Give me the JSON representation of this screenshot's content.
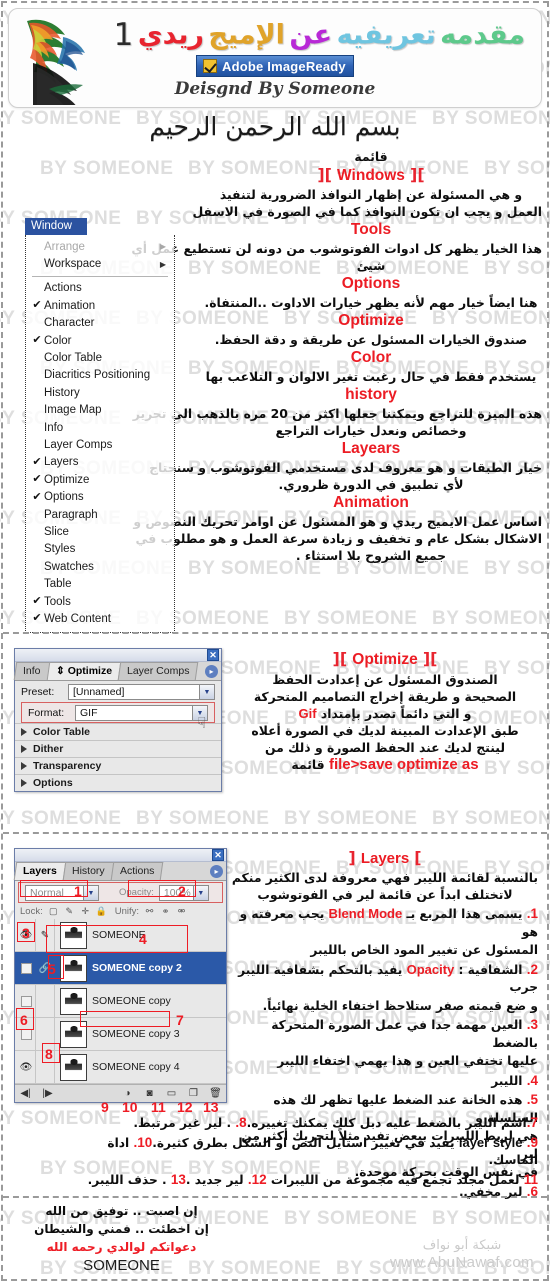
{
  "header": {
    "title_parts": [
      {
        "text": "مقدمه",
        "color": "#5dc98b"
      },
      {
        "text": "تعريفيه",
        "color": "#6fc5e0"
      },
      {
        "text": "عن",
        "color": "#b829d6"
      },
      {
        "text": "الإميج",
        "color": "#e0a32a"
      },
      {
        "text": "ريدي",
        "color": "#e8242f"
      },
      {
        "text": "1",
        "color": "#2b2b2b"
      }
    ],
    "app_badge": "Adobe ImageReady",
    "app_badge_icon": "imageready-icon",
    "designed_by": "Deisgnd By Someone"
  },
  "basmala": "بسم الله الرحمن الرحيم",
  "watermark_text": "BY SOMEONE",
  "section1": {
    "menu": {
      "title": "Window",
      "items": [
        {
          "label": "Arrange",
          "checked": false,
          "disabled": true,
          "submenu": true
        },
        {
          "label": "Workspace",
          "checked": false,
          "disabled": false,
          "submenu": true
        },
        {
          "divider": true
        },
        {
          "label": "Actions",
          "checked": false,
          "disabled": false,
          "submenu": false
        },
        {
          "label": "Animation",
          "checked": true,
          "disabled": false,
          "submenu": false
        },
        {
          "label": "Character",
          "checked": false,
          "disabled": false,
          "submenu": false
        },
        {
          "label": "Color",
          "checked": true,
          "disabled": false,
          "submenu": false
        },
        {
          "label": "Color Table",
          "checked": false,
          "disabled": false,
          "submenu": false
        },
        {
          "label": "Diacritics Positioning",
          "checked": false,
          "disabled": false,
          "submenu": false
        },
        {
          "label": "History",
          "checked": false,
          "disabled": false,
          "submenu": false
        },
        {
          "label": "Image Map",
          "checked": false,
          "disabled": false,
          "submenu": false
        },
        {
          "label": "Info",
          "checked": false,
          "disabled": false,
          "submenu": false
        },
        {
          "label": "Layer Comps",
          "checked": false,
          "disabled": false,
          "submenu": false
        },
        {
          "label": "Layers",
          "checked": true,
          "disabled": false,
          "submenu": false
        },
        {
          "label": "Optimize",
          "checked": true,
          "disabled": false,
          "submenu": false
        },
        {
          "label": "Options",
          "checked": true,
          "disabled": false,
          "submenu": false
        },
        {
          "label": "Paragraph",
          "checked": false,
          "disabled": false,
          "submenu": false
        },
        {
          "label": "Slice",
          "checked": false,
          "disabled": false,
          "submenu": false
        },
        {
          "label": "Styles",
          "checked": false,
          "disabled": false,
          "submenu": false
        },
        {
          "label": "Swatches",
          "checked": false,
          "disabled": false,
          "submenu": false
        },
        {
          "label": "Table",
          "checked": false,
          "disabled": false,
          "submenu": false
        },
        {
          "label": "Tools",
          "checked": true,
          "disabled": false,
          "submenu": false
        },
        {
          "label": "Web Content",
          "checked": true,
          "disabled": false,
          "submenu": false
        }
      ]
    },
    "heading_word": "قائمة",
    "heading_keyword": "Windows",
    "intro_line1": "و هي المسئولة عن إظهار النوافذ الضرورية لتنفيذ",
    "intro_line2": "العمل و يجب ان تكون النوافذ كما في الصورة في الاسفل",
    "entries": [
      {
        "keyword": "Tools",
        "lines": [
          "هذا الخيار يظهر كل ادوات الفوتوشوب من دونه لن تستطيع عمل أي",
          "شيئ"
        ]
      },
      {
        "keyword": "Options",
        "lines": [
          "هنا ايضاً خيار مهم لأنه يظهر خيارات الاداوت ..المنتفاة."
        ]
      },
      {
        "keyword": "Optimize",
        "lines": [
          "صندوق الخيارات المسئول عن طريقة و دقة الحفظ."
        ]
      },
      {
        "keyword": "Color",
        "lines": [
          "يستخدم فقط في حال رغبت تغير الالوان و التلاعب بها"
        ]
      },
      {
        "keyword": "history",
        "lines": [
          "هذه الميزة للتراجع ويمكننا جعلها اكثر من 20 مره بالذهب الى تحرير",
          "وخصائص ونعدل خيارات التراجع"
        ]
      },
      {
        "keyword": "Layears",
        "lines": [
          "خيار الطبقات و هو معروف لدى مستخدمي الفوتوشوب و سنحتاج",
          "لأي تطبيق في  الدورة ظروري."
        ]
      },
      {
        "keyword": "Animation",
        "lines": [
          "اساس عمل الايميج ريدي و هو المسئول عن اوامر تحريك النصوص و",
          "الاشكال بشكل عام و تخفيف و زيادة سرعة العمل و هو مطلوب في",
          "جميع الشروح بلا استثاء ."
        ]
      }
    ]
  },
  "section2": {
    "panel": {
      "close_icon": "close-icon",
      "tabs": [
        {
          "label": "Info",
          "active": false
        },
        {
          "label": "Optimize",
          "active": true
        },
        {
          "label": "Layer Comps",
          "active": false
        }
      ],
      "menu_icon": "panel-menu-icon",
      "hand_icon": "hand-icon",
      "preset_label": "Preset:",
      "preset_value": "[Unnamed]",
      "format_label": "Format:",
      "format_value": "GIF",
      "collapsed_sections": [
        "Color Table",
        "Dither",
        "Transparency",
        "Options"
      ]
    },
    "heading_keyword": "Optimize",
    "lines": [
      "الصندوق المسئول عن إعدادت الحفظ",
      "الصحيحة و طريقة إخراج التصاميم المتحركة"
    ],
    "line_gif_pre": "و التي دائماً تصدر بإمتداد",
    "line_gif_kw": "Gif",
    "lines2": [
      "طبق الإعدادت المبينة لديك في  الصورة أعلاه",
      "لينتج لديك عند الحفظ الصورة و ذلك من"
    ],
    "line_save_pre": "قائمة",
    "line_save_kw": "file>save optimize as"
  },
  "section3": {
    "panel": {
      "close_icon": "close-icon",
      "tabs": [
        {
          "label": "Layers",
          "active": true
        },
        {
          "label": "History",
          "active": false
        },
        {
          "label": "Actions",
          "active": false
        }
      ],
      "menu_icon": "panel-menu-icon",
      "blend_mode_value": "Normal",
      "opacity_label": "Opacity:",
      "opacity_value": "100%",
      "lock_label": "Lock:",
      "unify_label": "Unify:",
      "layers": [
        {
          "name": "SOMEONE",
          "visible": true,
          "selected": false,
          "linked": false
        },
        {
          "name": "SOMEONE copy 2",
          "visible": false,
          "selected": true,
          "linked": true
        },
        {
          "name": "SOMEONE copy",
          "visible": false,
          "selected": false,
          "linked": false
        },
        {
          "name": "SOMEONE copy 3",
          "visible": false,
          "selected": false,
          "linked": false
        },
        {
          "name": "SOMEONE copy 4",
          "visible": true,
          "selected": false,
          "linked": false
        }
      ],
      "footer_icons": [
        "nav-prev-icon",
        "nav-next-icon",
        "layer-style-icon",
        "mask-icon",
        "new-group-icon",
        "new-layer-icon",
        "delete-layer-icon"
      ],
      "annotations": [
        "1",
        "2",
        "3",
        "4",
        "5",
        "6",
        "7",
        "8",
        "9",
        "10",
        "11",
        "12",
        "13"
      ]
    },
    "heading_keyword": "Layers",
    "intro_lines": [
      "بالنسبة لقائمة الليبر فهي معروفة لدى الكثير منكم فهي",
      "لاتختلف ابداً عن قائمة لير في الفوتوشوب"
    ],
    "items": [
      {
        "num": "1.",
        "pre": "يسمى هذا المربع بـ",
        "kw": "Blend Mode",
        "post": "يجب معرفته و هو",
        "cont": "المسئول عن تغيير المود الخاص بالليبر"
      },
      {
        "num": "2.",
        "pre": "الشفافية :",
        "kw": "Opacity",
        "post": "يفيد بالتحكم بشفافية الليبر جرب",
        "cont": "و ضع قيمته صفر ستلاحظ اختفاء الخلية نهائياً."
      },
      {
        "num": "3.",
        "pre": "العين مهمة جدا في عمل الصورة المتحركة بالضغط",
        "kw": "",
        "post": "",
        "cont": "عليها تختفي العين و هذا يهمي اختفاء الليبر"
      },
      {
        "num": "4.",
        "pre": "الليبر",
        "kw": "",
        "post": "",
        "cont": ""
      },
      {
        "num": "5.",
        "pre": "هذه الخانة عند الضغط عليها تظهر لك هذه السلسلة و",
        "kw": "",
        "post": "",
        "cont": "هي لربط الليبرات ببعض تفيد مثلاً لتحريك أكثر من لير",
        "cont2": "في نفس الوقت بحركة موحدة."
      },
      {
        "num": "6.",
        "pre": "لير مخفي.",
        "kw": "",
        "post": "",
        "cont": ""
      }
    ],
    "tail_lines": [
      {
        "segments": [
          {
            "t": "7.",
            "red": true
          },
          {
            "t": "اسم الليبر بالضغط عليه دبل كلك يمكنك تغييره.",
            "red": false
          },
          {
            "t": "8.",
            "red": true
          },
          {
            "t": " . لير غير مرتبط.",
            "red": false
          }
        ]
      },
      {
        "segments": [
          {
            "t": "9.",
            "red": true
          },
          {
            "t": " ",
            "red": false
          },
          {
            "t": "layer style",
            "red": false,
            "ltr": true
          },
          {
            "t": " يفيد في تغيير استايل النص او الشكل بطرق كثيرة.",
            "red": false
          },
          {
            "t": "10.",
            "red": true
          },
          {
            "t": " اداة الماسك.",
            "red": false
          }
        ]
      },
      {
        "segments": [
          {
            "t": "11",
            "red": true
          },
          {
            "t": " لعمل مجلد تجمع فيه مجموعة من الليبرات ",
            "red": false
          },
          {
            "t": "12.",
            "red": true
          },
          {
            "t": " لير جديد .",
            "red": false
          },
          {
            "t": "13",
            "red": true
          },
          {
            "t": " . حذف الليبر.",
            "red": false
          }
        ]
      }
    ]
  },
  "footer": {
    "left_lines": [
      {
        "text": "إن اصبت .. توفيق من الله",
        "red": false
      },
      {
        "text": "إن اخطئت .. فمني والشيطان",
        "red": false
      },
      {
        "text": "دعواتكم لوالدي رحمه الله",
        "red": true
      }
    ],
    "signature": "SOMEONE",
    "site_arabic": "شبكة أبو نواف",
    "site_url": "www.AbuNawaf.com"
  }
}
